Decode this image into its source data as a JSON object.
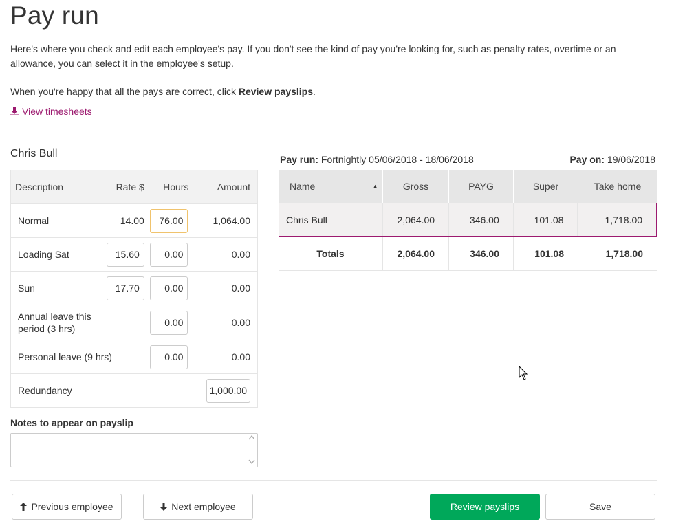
{
  "page": {
    "title": "Pay run",
    "intro": "Here's where you check and edit each employee's pay. If you don't see the kind of pay you're looking for, such as penalty rates, overtime or an allowance, you can select it in the employee's setup.",
    "instruction_prefix": "When you're happy that all the pays are correct, click ",
    "instruction_bold": "Review payslips",
    "instruction_suffix": ".",
    "view_timesheets": "View timesheets"
  },
  "employee": {
    "name": "Chris Bull",
    "table": {
      "headers": {
        "description": "Description",
        "rate": "Rate $",
        "hours": "Hours",
        "amount": "Amount"
      },
      "rows": [
        {
          "description": "Normal",
          "rate": "14.00",
          "hours": "76.00",
          "amount": "1,064.00"
        },
        {
          "description": "Loading Sat",
          "rate": "15.60",
          "hours": "0.00",
          "amount": "0.00"
        },
        {
          "description": "Sun",
          "rate": "17.70",
          "hours": "0.00",
          "amount": "0.00"
        },
        {
          "description": "Annual leave this period (3 hrs)",
          "rate": "",
          "hours": "0.00",
          "amount": "0.00"
        },
        {
          "description": "Personal leave (9 hrs)",
          "rate": "",
          "hours": "0.00",
          "amount": "0.00"
        },
        {
          "description": "Redundancy",
          "rate": "",
          "hours": "",
          "amount": "1,000.00"
        }
      ]
    },
    "notes_label": "Notes to appear on payslip",
    "notes_value": ""
  },
  "summary": {
    "payrun_label": "Pay run:",
    "payrun_value": "Fortnightly 05/06/2018 - 18/06/2018",
    "payon_label": "Pay on:",
    "payon_value": "19/06/2018",
    "headers": {
      "name": "Name",
      "gross": "Gross",
      "payg": "PAYG",
      "super": "Super",
      "take_home": "Take home"
    },
    "rows": [
      {
        "name": "Chris Bull",
        "gross": "2,064.00",
        "payg": "346.00",
        "super": "101.08",
        "take_home": "1,718.00"
      }
    ],
    "totals": {
      "label": "Totals",
      "gross": "2,064.00",
      "payg": "346.00",
      "super": "101.08",
      "take_home": "1,718.00"
    }
  },
  "footer": {
    "prev": "Previous employee",
    "next": "Next employee",
    "review": "Review payslips",
    "save": "Save"
  },
  "colors": {
    "accent": "#9c1a6f",
    "primary_button": "#00a85a",
    "focus_border": "#f0c36d"
  }
}
